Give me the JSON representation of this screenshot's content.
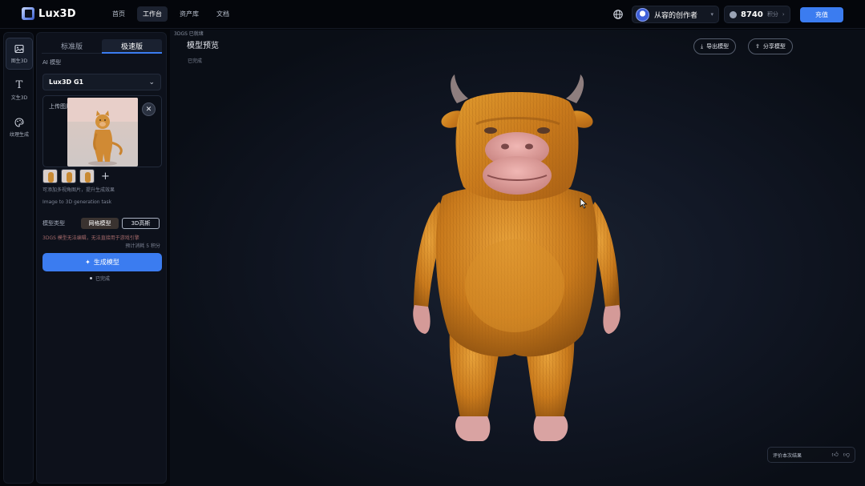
{
  "app": {
    "name": "Lux3D"
  },
  "nav": {
    "items": [
      {
        "label": "首页",
        "active": false
      },
      {
        "label": "工作台",
        "active": true
      },
      {
        "label": "资产库",
        "active": false
      },
      {
        "label": "文档",
        "active": false
      }
    ]
  },
  "header": {
    "user_name": "从容的创作者",
    "credits": "8740",
    "credits_unit": "积分",
    "recharge_label": "充值"
  },
  "rail": {
    "items": [
      {
        "label": "图生3D",
        "icon": "image-icon",
        "active": true
      },
      {
        "label": "文生3D",
        "icon": "text-icon",
        "active": false
      },
      {
        "label": "纹理生成",
        "icon": "palette-icon",
        "active": false
      }
    ]
  },
  "panel": {
    "tabs": [
      {
        "label": "标准版",
        "active": false
      },
      {
        "label": "极速版",
        "active": true
      }
    ],
    "ai_model_label": "AI 模型",
    "model_value": "Lux3D G1",
    "upload_label": "上传图片",
    "multi_view_hint": "可添加多视角图片，提升生成效果",
    "task_hint": "Image to 3D generation task",
    "model_type_label": "模型类型",
    "type_options": [
      {
        "label": "网格模型",
        "state": "active"
      },
      {
        "label": "3D高斯",
        "state": "outline"
      }
    ],
    "warning": "3DGS 模型无法编辑，无法直接用于游戏引擎",
    "cost": "预计消耗 5 积分",
    "generate_label": "生成模型",
    "status": "已完成"
  },
  "viewport": {
    "breadcrumb": "3DGS 已就绪",
    "title": "模型预览",
    "subtitle": "已完成",
    "export_label": "导出模型",
    "share_label": "分享模型",
    "feedback_text": "评价本次结果"
  },
  "colors": {
    "accent": "#3b7cf0",
    "fur": "#d4841f",
    "skin": "#e3a7a6",
    "background": "#05070c"
  }
}
